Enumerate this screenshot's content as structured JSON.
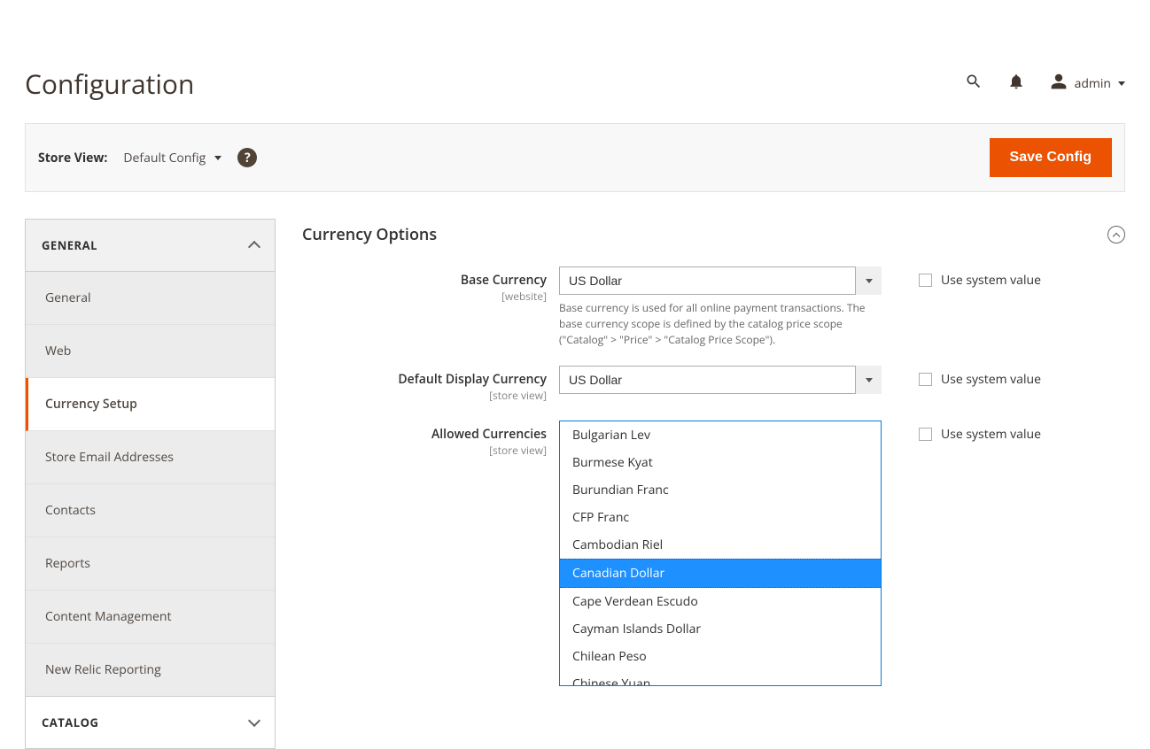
{
  "header": {
    "title": "Configuration",
    "user": "admin"
  },
  "toolbar": {
    "store_view_label": "Store View:",
    "store_view_value": "Default Config",
    "save_label": "Save Config"
  },
  "sidebar": {
    "sections": [
      {
        "title": "GENERAL",
        "expanded": true
      },
      {
        "title": "CATALOG",
        "expanded": false
      }
    ],
    "items": [
      "General",
      "Web",
      "Currency Setup",
      "Store Email Addresses",
      "Contacts",
      "Reports",
      "Content Management",
      "New Relic Reporting"
    ],
    "active_index": 2
  },
  "main": {
    "section_title": "Currency Options",
    "use_system_value": "Use system value",
    "fields": {
      "base_currency": {
        "label": "Base Currency",
        "scope": "[website]",
        "value": "US Dollar",
        "note": "Base currency is used for all online payment transactions. The base currency scope is defined by the catalog price scope (\"Catalog\" > \"Price\" > \"Catalog Price Scope\")."
      },
      "default_display_currency": {
        "label": "Default Display Currency",
        "scope": "[store view]",
        "value": "US Dollar"
      },
      "allowed_currencies": {
        "label": "Allowed Currencies",
        "scope": "[store view]",
        "options": [
          "Bulgarian Lev",
          "Burmese Kyat",
          "Burundian Franc",
          "CFP Franc",
          "Cambodian Riel",
          "Canadian Dollar",
          "Cape Verdean Escudo",
          "Cayman Islands Dollar",
          "Chilean Peso",
          "Chinese Yuan"
        ],
        "selected": "Canadian Dollar"
      }
    }
  }
}
